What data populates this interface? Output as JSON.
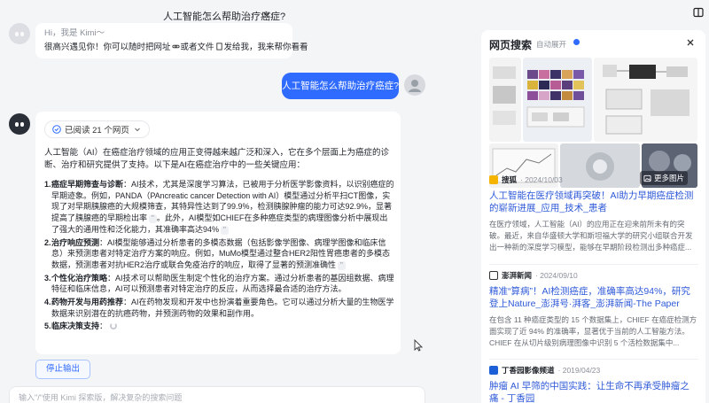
{
  "conversation": {
    "title": "人工智能怎么帮助治疗癌症?"
  },
  "greeting": {
    "line1": "Hi，我是 Kimi～",
    "line2_a": "很高兴遇见你！你可以随时把网址",
    "line2_b": "或者文件",
    "line2_c": "发给我，我来帮你看看"
  },
  "user_message": "人工智能怎么帮助治疗癌症?",
  "answer": {
    "read_pill": "已阅读 21 个网页",
    "intro": "人工智能（AI）在癌症治疗领域的应用正变得越来越广泛和深入，它在多个层面上为癌症的诊断、治疗和研究提供了支持。以下是AI在癌症治疗中的一些关键应用：",
    "points": [
      {
        "num": "1.",
        "title": "癌症早期筛查与诊断",
        "body": "：AI技术，尤其是深度学习算法，已被用于分析医学影像资料，以识别癌症的早期迹象。例如，PANDA（PAncreatic cancer Detection with AI）模型通过分析平扫CT图像，实现了对早期胰腺癌的大规模筛查，其特异性达到了99.9%，检测胰腺肿瘤的能力可达92.9%，显著提高了胰腺癌的早期检出率",
        "cite1": "\"",
        "body2": "。此外，AI模型如CHIEF在多种癌症类型的病理图像分析中展现出了强大的通用性和泛化能力，其准确率高达94%",
        "cite2": "\""
      },
      {
        "num": "2.",
        "title": "治疗响应预测",
        "body": "：AI模型能够通过分析患者的多模态数据（包括影像学图像、病理学图像和临床信息）来预测患者对特定治疗方案的响应。例如，MuMo模型通过整合HER2阳性胃癌患者的多模态数据，预测患者对抗HER2治疗或联合免疫治疗的响应，取得了显著的预测准确性",
        "cite1": "\""
      },
      {
        "num": "3.",
        "title": "个性化治疗策略",
        "body": "：AI技术可以帮助医生制定个性化的治疗方案。通过分析患者的基因组数据、病理特征和临床信息，AI可以预测患者对特定治疗的反应，从而选择最合适的治疗方法。"
      },
      {
        "num": "4.",
        "title": "药物开发与用药推荐",
        "body": "：AI在药物发现和开发中也扮演着重要角色。它可以通过分析大量的生物医学数据来识别潜在的抗癌药物，并预测药物的效果和副作用。"
      },
      {
        "num": "5.",
        "title": "临床决策支持",
        "body": "："
      }
    ]
  },
  "stop_button": "停止输出",
  "input": {
    "placeholder": "输入\"/\"使用 Kimi 探索版，解决复杂的搜索问题"
  },
  "search_panel": {
    "title": "网页搜索",
    "auto_expand": "自动展开",
    "more_images": "更多图片",
    "results": [
      {
        "source": "搜狐",
        "date": "2024/10/03",
        "title": "人工智能在医疗领域再突破！AI助力早期癌症检测的崭新进展_应用_技术_患者",
        "snippet": "在医疗领域，人工智能（AI）的应用正在迎来前所未有的突破。最近，来自华盛顿大学和斯坦福大学的研究小组联合开发出一种新的深度学习模型，能够在早期阶段检测出多种癌症..."
      },
      {
        "source": "澎湃新闻",
        "date": "2024/09/10",
        "title": "精准“算病”！AI检测癌症，准确率高达94%，研究登上Nature_澎湃号·湃客_澎湃新闻-The Paper",
        "snippet": "在包含 11 种癌症类型的 15 个数据集上，CHIEF 在癌症检测方面实现了近 94% 的准确率，显著优于当前的人工智能方法。CHIEF 在从切片级别病理图像中识别 5 个活检数据集中..."
      },
      {
        "source": "丁香园影像频道",
        "date": "2019/04/23",
        "title": "肿瘤 AI 早筛的中国实践：让生命不再承受肿瘤之痛 - 丁香园",
        "snippet": ""
      }
    ]
  }
}
